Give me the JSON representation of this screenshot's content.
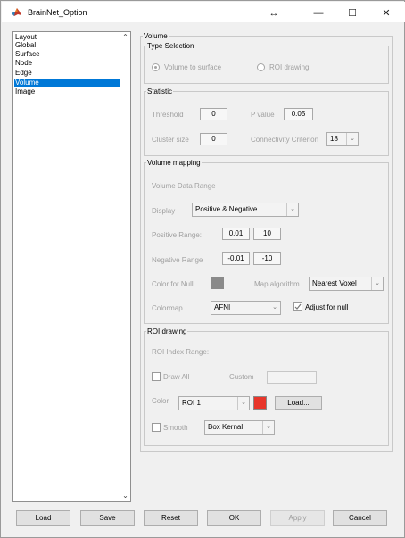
{
  "window": {
    "title": "BrainNet_Option",
    "controls": {
      "resize": "↔",
      "minimize": "—",
      "maximize": "☐",
      "close": "✕"
    }
  },
  "sidebar": {
    "items": [
      {
        "label": "Layout"
      },
      {
        "label": "Global"
      },
      {
        "label": "Surface"
      },
      {
        "label": "Node"
      },
      {
        "label": "Edge"
      },
      {
        "label": "Volume"
      },
      {
        "label": "Image"
      }
    ],
    "selected": "Volume"
  },
  "volume": {
    "title": "Volume",
    "type_selection": {
      "title": "Type Selection",
      "volume_to_surface": "Volume to surface",
      "roi_drawing": "ROI drawing",
      "selected": "Volume to surface"
    },
    "statistic": {
      "title": "Statistic",
      "threshold_label": "Threshold",
      "threshold_value": "0",
      "pvalue_label": "P value",
      "pvalue_value": "0.05",
      "cluster_label": "Cluster size",
      "cluster_value": "0",
      "connectivity_label": "Connectivity Criterion",
      "connectivity_value": "18"
    },
    "mapping": {
      "title": "Volume mapping",
      "data_range_label": "Volume Data Range",
      "display_label": "Display",
      "display_value": "Positive & Negative",
      "positive_label": "Positive Range:",
      "positive_min": "0.01",
      "positive_max": "10",
      "negative_label": "Negative Range",
      "negative_min": "-0.01",
      "negative_max": "-10",
      "color_null_label": "Color for Null",
      "map_algorithm_label": "Map algorithm",
      "map_algorithm_value": "Nearest Voxel",
      "colormap_label": "Colormap",
      "colormap_value": "AFNI",
      "adjust_null_label": "Adjust for null",
      "adjust_null_checked": true
    },
    "roi": {
      "title": "ROI drawing",
      "index_range_label": "ROI Index Range:",
      "draw_all_label": "Draw All",
      "custom_label": "Custom",
      "custom_value": "",
      "color_label": "Color",
      "color_value": "ROI 1",
      "load_label": "Load...",
      "smooth_label": "Smooth",
      "smooth_value": "Box Kernal"
    }
  },
  "buttons": {
    "load": "Load",
    "save": "Save",
    "reset": "Reset",
    "ok": "OK",
    "apply": "Apply",
    "cancel": "Cancel"
  },
  "colors": {
    "selection": "#0078d7",
    "roi_swatch": "#e8362b",
    "null_swatch": "#8a8a8a"
  }
}
